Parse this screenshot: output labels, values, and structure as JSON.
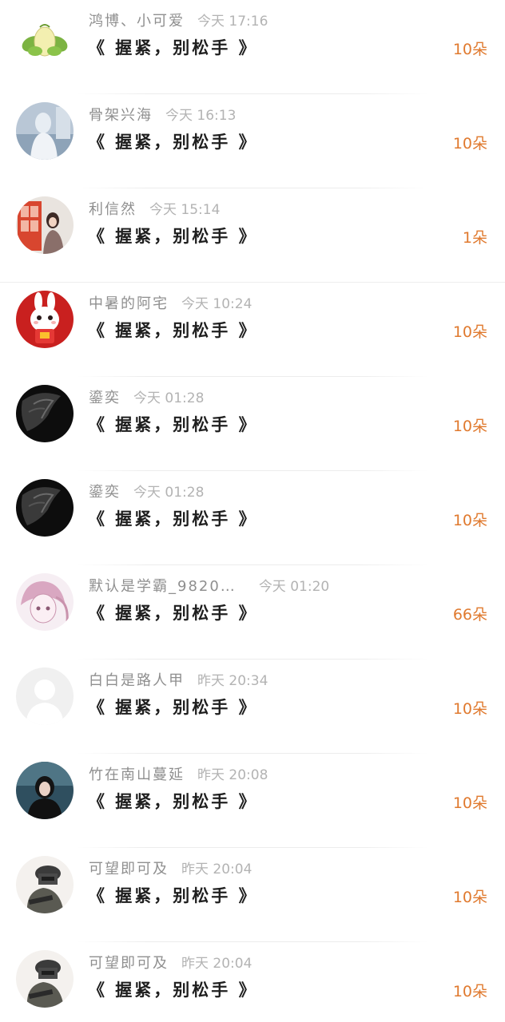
{
  "rows": [
    {
      "username": "鸿博、小可爱",
      "time": "今天 17:16",
      "title": "《 握紧，别松手 》",
      "count": "10朵",
      "avatar": "leaf-avatar"
    },
    {
      "username": "骨架兴海",
      "time": "今天 16:13",
      "title": "《 握紧，别松手 》",
      "count": "10朵",
      "avatar": "photo-avatar-light"
    },
    {
      "username": "利信然",
      "time": "今天 15:14",
      "title": "《 握紧，别松手 》",
      "count": "1朵",
      "avatar": "photo-avatar-red-booth"
    },
    {
      "username": "中暑的阿宅",
      "time": "今天 10:24",
      "title": "《 握紧，别松手 》",
      "count": "10朵",
      "avatar": "rabbit-avatar"
    },
    {
      "username": "鎏奕",
      "time": "今天 01:28",
      "title": "《 握紧，别松手 》",
      "count": "10朵",
      "avatar": "dark-abstract-avatar"
    },
    {
      "username": "鎏奕",
      "time": "今天 01:28",
      "title": "《 握紧，别松手 》",
      "count": "10朵",
      "avatar": "dark-abstract-avatar"
    },
    {
      "username": "默认是学霸_9820…",
      "time": "今天 01:20",
      "title": "《 握紧，别松手 》",
      "count": "66朵",
      "avatar": "anime-sketch-avatar"
    },
    {
      "username": "白白是路人甲",
      "time": "昨天 20:34",
      "title": "《 握紧，别松手 》",
      "count": "10朵",
      "avatar": "default-user-avatar"
    },
    {
      "username": "竹在南山蔓延",
      "time": "昨天 20:08",
      "title": "《 握紧，别松手 》",
      "count": "10朵",
      "avatar": "portrait-avatar-dark"
    },
    {
      "username": "可望即可及",
      "time": "昨天 20:04",
      "title": "《 握紧，别松手 》",
      "count": "10朵",
      "avatar": "soldier-avatar"
    },
    {
      "username": "可望即可及",
      "time": "昨天 20:04",
      "title": "《 握紧，别松手 》",
      "count": "10朵",
      "avatar": "soldier-avatar"
    }
  ],
  "colors": {
    "username": "#8f8f8f",
    "time": "#b3b3b3",
    "title": "#1f1f1f",
    "count": "#e07a2f"
  }
}
